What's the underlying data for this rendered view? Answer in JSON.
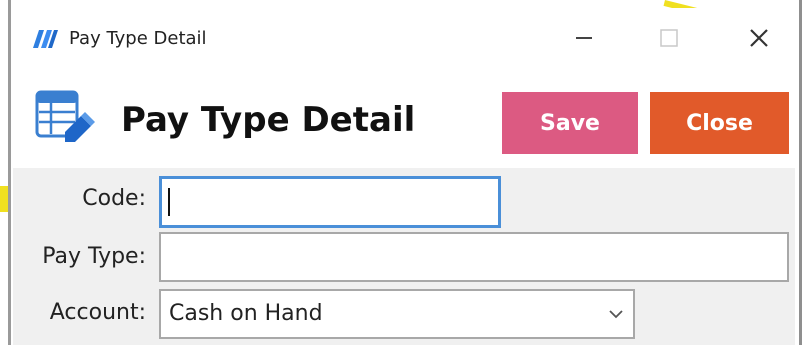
{
  "window": {
    "title": "Pay Type Detail",
    "app_icon": "app-logo-icon",
    "controls": {
      "minimize": "minimize-icon",
      "maximize": "maximize-icon",
      "close": "close-icon"
    }
  },
  "header": {
    "icon": "form-table-edit-icon",
    "title": "Pay Type Detail",
    "save_label": "Save",
    "close_label": "Close"
  },
  "form": {
    "code": {
      "label": "Code:",
      "value": ""
    },
    "pay_type": {
      "label": "Pay Type:",
      "value": ""
    },
    "account": {
      "label": "Account:",
      "selected": "Cash on Hand",
      "icon": "chevron-down-icon"
    }
  },
  "colors": {
    "save_button": "#dc5a82",
    "close_button": "#e15a2a",
    "focus_border": "#4a8fd8",
    "form_background": "#f0f0f0"
  }
}
